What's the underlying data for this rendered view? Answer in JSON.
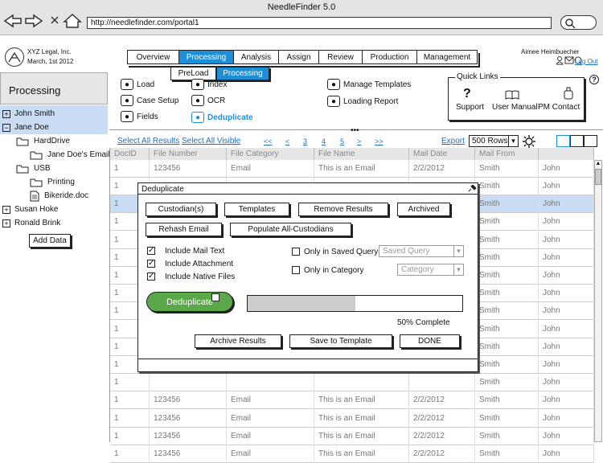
{
  "window": {
    "title": "NeedleFinder 5.0",
    "url": "http://needlefinder.com/portal1"
  },
  "company": {
    "name": "XYZ Legal, Inc.",
    "date": "March, 1st 2012"
  },
  "user": {
    "name": "Aimee Heimbuecher",
    "logout": "Log Out"
  },
  "nav": {
    "tabs": [
      "Overview",
      "Processing",
      "Analysis",
      "Assign",
      "Review",
      "Production",
      "Management"
    ],
    "active": "Processing",
    "subtabs": [
      "PreLoad",
      "Processing"
    ]
  },
  "left_panel": {
    "title": "Processing",
    "tree": [
      {
        "label": "John Smith",
        "toggle": "+"
      },
      {
        "label": "Jane Doe",
        "toggle": "−"
      },
      {
        "label": "HardDrive"
      },
      {
        "label": "Jane Doe's Email"
      },
      {
        "label": "USB"
      },
      {
        "label": "Printing"
      },
      {
        "label": "Bikeride.doc"
      },
      {
        "label": "Susan Hoke",
        "toggle": "+"
      },
      {
        "label": "Ronald Brink",
        "toggle": "+"
      }
    ],
    "add_data": "Add Data"
  },
  "actions": {
    "col1": [
      "Load",
      "Case Setup",
      "Fields"
    ],
    "col2": [
      "Index",
      "OCR",
      "Deduplicate"
    ],
    "col3": [
      "Manage Templates",
      "Loading Report"
    ]
  },
  "quick_links": {
    "title": "Quick Links",
    "items": [
      "Support",
      "User Manual",
      "PM Contact"
    ],
    "help": "?"
  },
  "toolbar": {
    "select_all_results": "Select All Results",
    "select_all_visible": "Select All Visible",
    "pager": [
      "<<",
      "<",
      "3",
      "4",
      "5",
      ">",
      ">>"
    ],
    "export": "Export",
    "rows": "500 Rows"
  },
  "grid": {
    "headers": [
      "DocID",
      "File Number",
      "File Category",
      "File Name",
      "Mail Date",
      "Mail From",
      ""
    ],
    "first_row": [
      "1",
      "123456",
      "Email",
      "This is an Email",
      "2/2/2012",
      "Smith",
      "John"
    ],
    "rows": [
      [
        "1",
        "",
        "",
        "",
        "",
        "Smith",
        "John"
      ],
      [
        "1",
        "",
        "",
        "",
        "",
        "Smith",
        "John"
      ],
      [
        "1",
        "",
        "",
        "",
        "",
        "Smith",
        "John"
      ],
      [
        "1",
        "",
        "",
        "",
        "",
        "Smith",
        "John"
      ],
      [
        "1",
        "",
        "",
        "",
        "",
        "Smith",
        "John"
      ],
      [
        "1",
        "",
        "",
        "",
        "",
        "Smith",
        "John"
      ],
      [
        "1",
        "",
        "",
        "",
        "",
        "Smith",
        "John"
      ],
      [
        "1",
        "",
        "",
        "",
        "",
        "Smith",
        "John"
      ],
      [
        "1",
        "",
        "",
        "",
        "",
        "Smith",
        "John"
      ],
      [
        "1",
        "",
        "",
        "",
        "",
        "Smith",
        "John"
      ],
      [
        "1",
        "",
        "",
        "",
        "",
        "Smith",
        "John"
      ],
      [
        "1",
        "",
        "",
        "",
        "",
        "Smith",
        "John"
      ],
      [
        "1",
        "123456",
        "Email",
        "This is an Email",
        "2/2/2012",
        "Smith",
        "John"
      ],
      [
        "1",
        "123456",
        "Email",
        "This is an Email",
        "2/2/2012",
        "Smith",
        "John"
      ],
      [
        "1",
        "123456",
        "Email",
        "This is an Email",
        "2/2/2012",
        "Smith",
        "John"
      ],
      [
        "1",
        "123456",
        "Email",
        "This is an Email",
        "2/2/2012",
        "Smith",
        "John"
      ]
    ]
  },
  "dialog": {
    "title": "Deduplicate",
    "buttons_row1": [
      "Custodian(s)",
      "Templates",
      "Remove Results",
      "Archived"
    ],
    "buttons_row2": [
      "Rehash Email",
      "Populate All-Custodians"
    ],
    "checks": [
      "Include Mail Text",
      "Include Attachment",
      "Include Native Files"
    ],
    "only_saved_query": "Only in Saved Query",
    "saved_query_placeholder": "Saved Query",
    "only_category": "Only in Category",
    "category_placeholder": "Category",
    "primary": "Deduplicate",
    "progress": 0.5,
    "progress_label": "50% Complete",
    "footer_buttons": [
      "Archive Results",
      "Save to Template",
      "DONE"
    ]
  }
}
